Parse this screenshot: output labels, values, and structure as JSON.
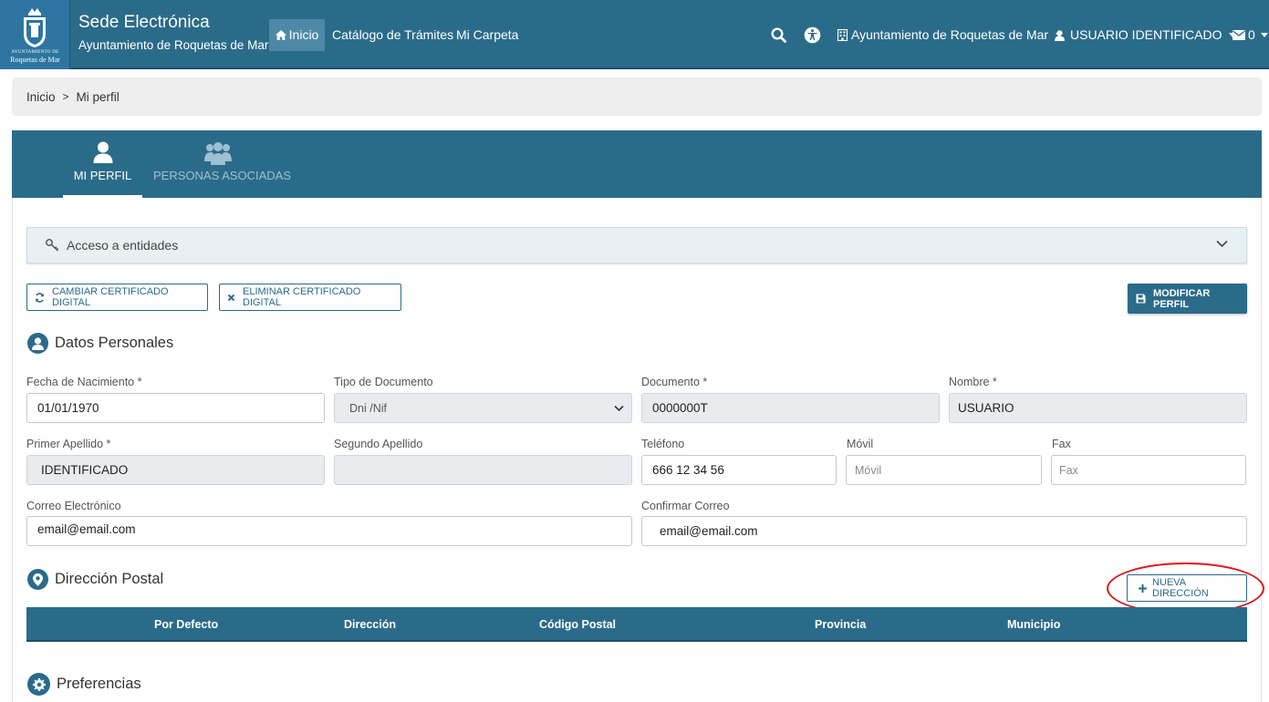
{
  "header": {
    "logo": {
      "line1": "AYUNTAMIENTO DE",
      "line2": "Roquetas de Mar"
    },
    "title": "Sede Electrónica",
    "subtitle": "Ayuntamiento de Roquetas de Mar",
    "nav": {
      "inicio": "Inicio",
      "catalogo": "Catálogo de Trámites",
      "carpeta": "Mi Carpeta"
    },
    "entity_menu": "Ayuntamiento de Roquetas de Mar",
    "user_menu": "USUARIO IDENTIFICADO",
    "messages_count": "0"
  },
  "breadcrumb": {
    "home": "Inicio",
    "sep": ">",
    "current": "Mi perfil"
  },
  "profile_tabs": {
    "mi_perfil": "MI PERFIL",
    "personas_asociadas": "PERSONAS ASOCIADAS"
  },
  "accordion": {
    "label": "Acceso a entidades"
  },
  "actions": {
    "cambiar": "CAMBIAR CERTIFICADO DIGITAL",
    "eliminar": "ELIMINAR CERTIFICADO DIGITAL",
    "modificar": "MODIFICAR PERFIL",
    "nueva_direccion": "NUEVA DIRECCIÓN"
  },
  "sections": {
    "datos_personales": "Datos Personales",
    "direccion_postal": "Dirección Postal",
    "preferencias": "Preferencias"
  },
  "form": {
    "fecha_nacimiento": {
      "label": "Fecha de Nacimiento *",
      "value": "01/01/1970"
    },
    "tipo_documento": {
      "label": "Tipo de Documento",
      "value": "Dni /Nif"
    },
    "documento": {
      "label": "Documento *",
      "value": "0000000T"
    },
    "nombre": {
      "label": "Nombre *",
      "value": "USUARIO"
    },
    "primer_apellido": {
      "label": "Primer Apellido *",
      "value": "IDENTIFICADO"
    },
    "segundo_apellido": {
      "label": "Segundo Apellido",
      "value": ""
    },
    "telefono": {
      "label": "Teléfono",
      "value": "666 12 34 56"
    },
    "movil": {
      "label": "Móvil",
      "placeholder": "Móvil"
    },
    "fax": {
      "label": "Fax",
      "placeholder": "Fax"
    },
    "correo": {
      "label": "Correo Electrónico",
      "value": "email@email.com"
    },
    "confirmar_correo": {
      "label": "Confirmar Correo",
      "value": "email@email.com"
    }
  },
  "address_table": {
    "columns": [
      "Por Defecto",
      "Dirección",
      "Código Postal",
      "Provincia",
      "Municipio"
    ]
  },
  "colors": {
    "primary": "#2b6b8a",
    "highlight": "#e0141c"
  }
}
